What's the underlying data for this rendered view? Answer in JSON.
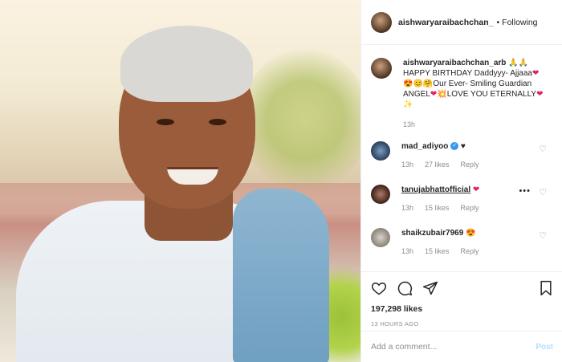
{
  "header": {
    "username": "aishwaryaraibachchan_",
    "follow_dot": "•",
    "follow_label": "Following"
  },
  "caption": {
    "username": "aishwaryaraibachchan_arb",
    "text_line1": "HAPPY BIRTHDAY Daddyyy- Ajjaaa",
    "text_line2": "Our Ever- Smiling Guardian",
    "text_line3": "ANGEL",
    "text_line3b": "LOVE YOU ETERNALLY",
    "time": "13h"
  },
  "comments": [
    {
      "username": "mad_adiyoo",
      "text": "♥",
      "time": "13h",
      "likes": "27 likes",
      "reply": "Reply",
      "verified": true
    },
    {
      "username": "tanujabhattofficial",
      "text": "❤",
      "time": "13h",
      "likes": "15 likes",
      "reply": "Reply",
      "verified": false
    },
    {
      "username": "shaikzubair7969",
      "text": "😍",
      "time": "13h",
      "likes": "15 likes",
      "reply": "Reply",
      "verified": false
    }
  ],
  "actions": {
    "likes": "197,298 likes",
    "posted": "13 HOURS AGO"
  },
  "add_comment": {
    "placeholder": "Add a comment...",
    "post_label": "Post"
  }
}
